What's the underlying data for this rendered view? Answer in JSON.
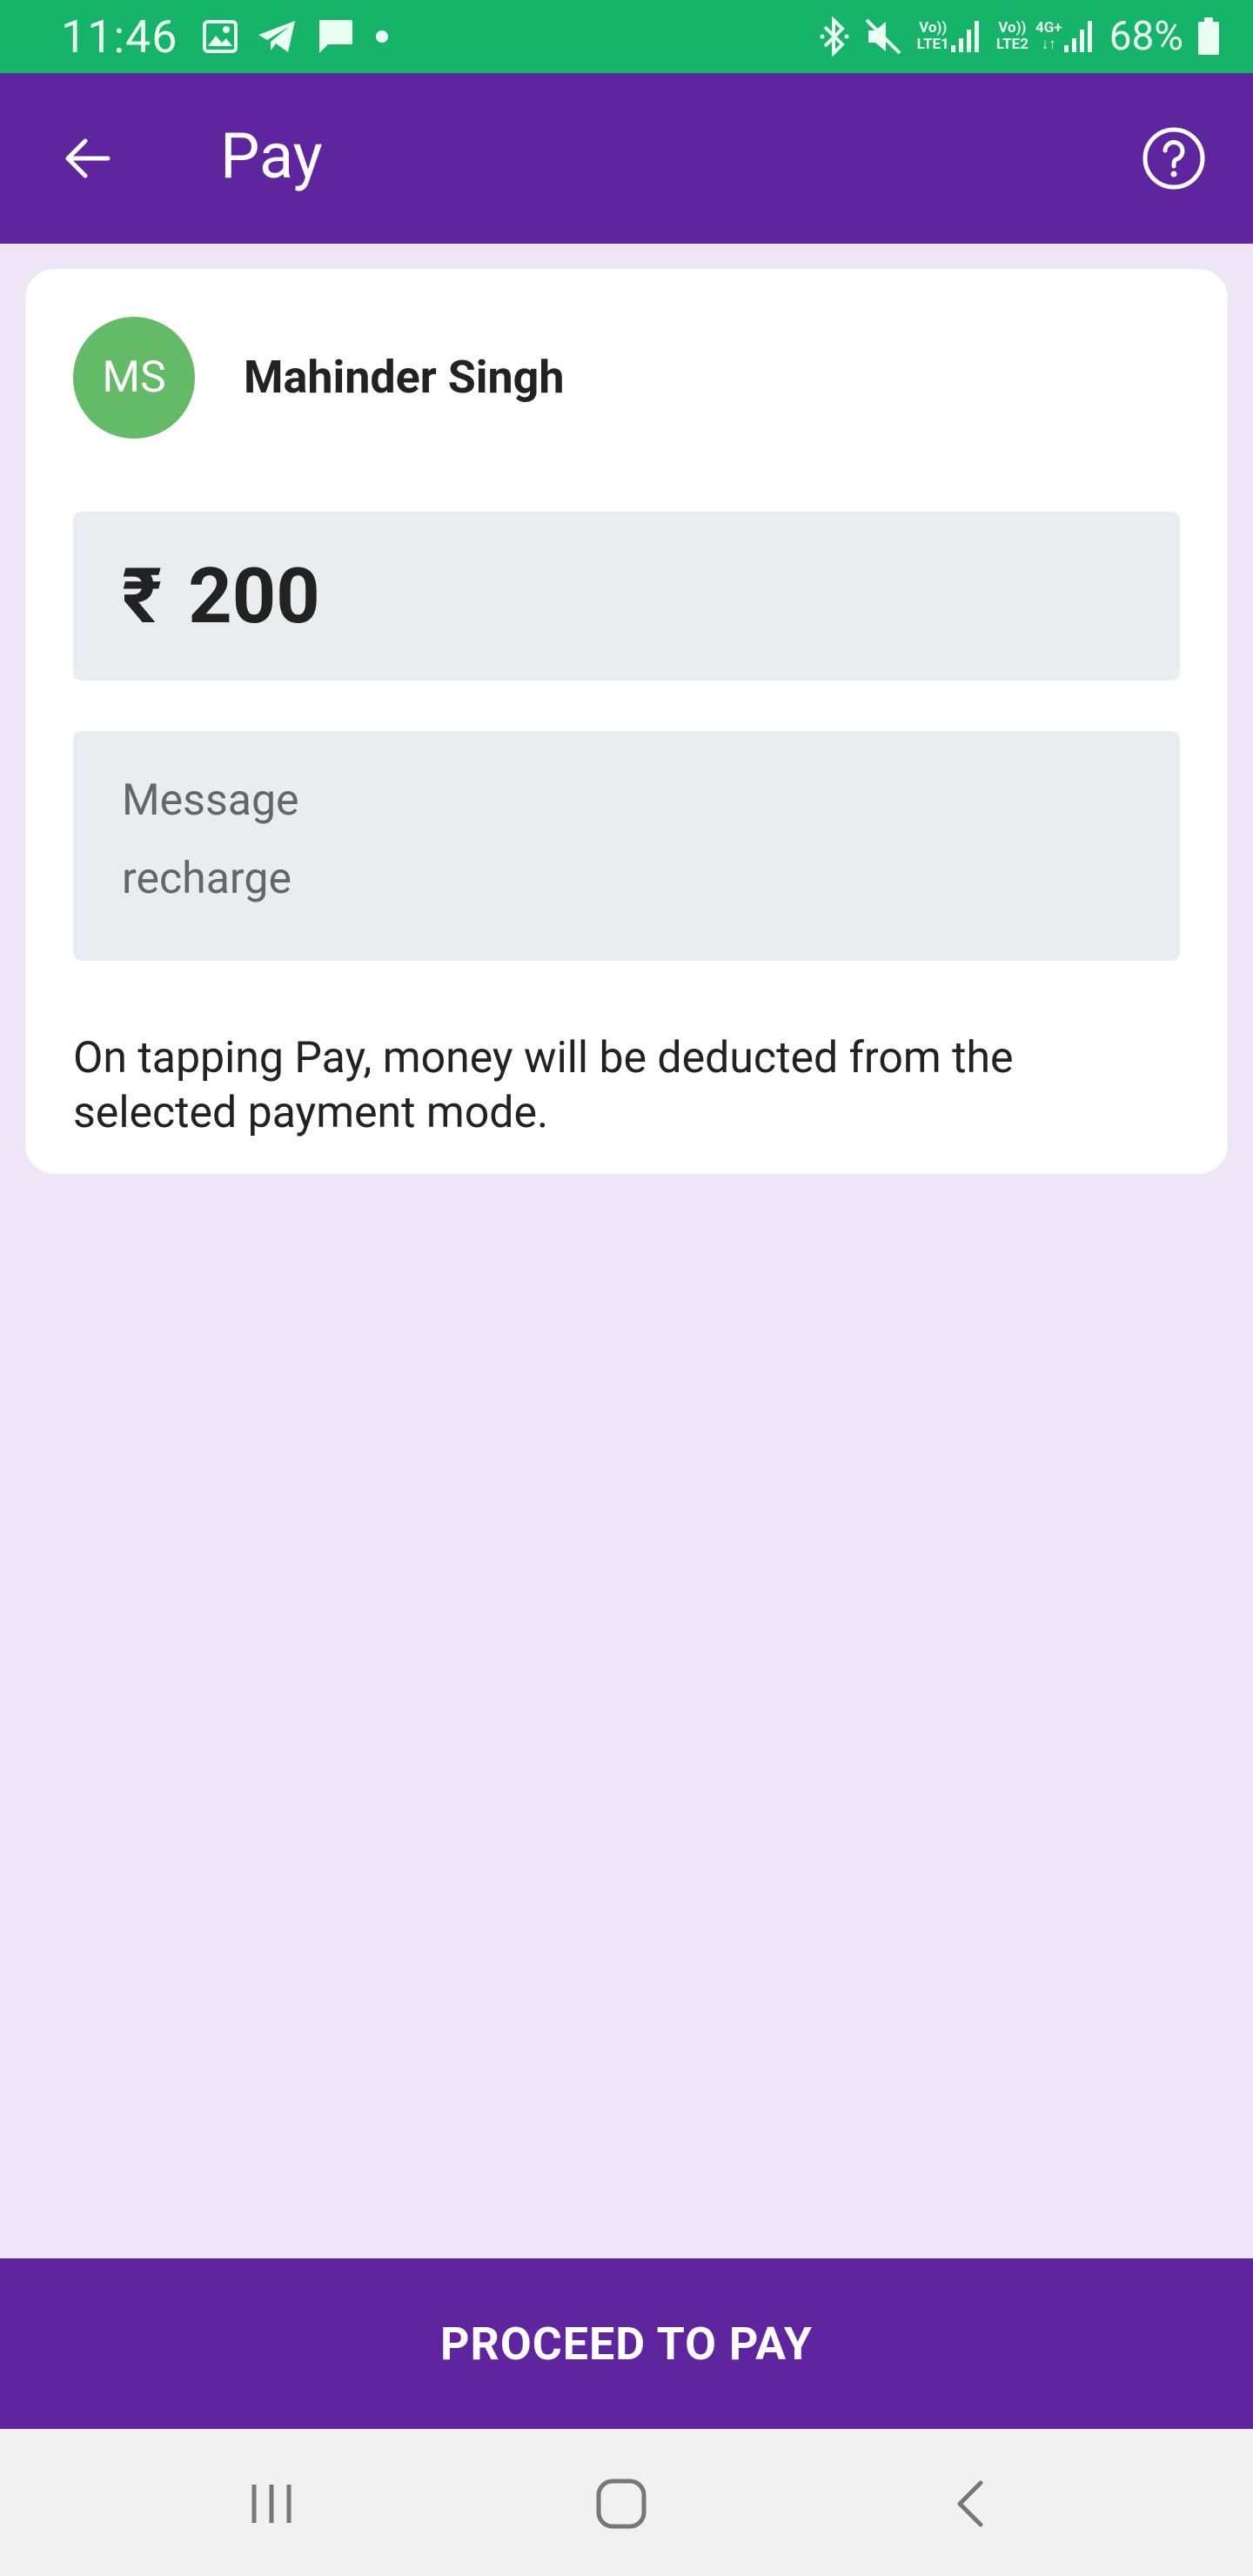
{
  "status_bar": {
    "time": "11:46",
    "battery": "68%",
    "sim1_label_top": "Vo))",
    "sim1_label_bottom": "LTE1",
    "sim2_label_top": "Vo))",
    "sim2_label_bottom": "LTE2",
    "net_type": "4G+",
    "left_icons": [
      "gallery-icon",
      "telegram-icon",
      "message-icon",
      "dot-icon"
    ],
    "right_icons": [
      "bluetooth-icon",
      "mute-icon",
      "signal-icon",
      "signal-icon",
      "battery-icon"
    ]
  },
  "app_bar": {
    "title": "Pay",
    "back_icon": "arrow-left-icon",
    "help_icon": "help-circle-icon"
  },
  "payee": {
    "initials": "MS",
    "name": "Mahinder Singh",
    "avatar_color": "#63BA67"
  },
  "amount": {
    "currency": "₹",
    "value": "200"
  },
  "message": {
    "label": "Message",
    "value": "recharge"
  },
  "disclaimer": "On tapping Pay, money will be deducted from the selected payment mode.",
  "proceed_button": "PROCEED TO PAY",
  "colors": {
    "brand": "#5F259F",
    "status_bar": "#16B468",
    "background": "#EEE5F7"
  }
}
